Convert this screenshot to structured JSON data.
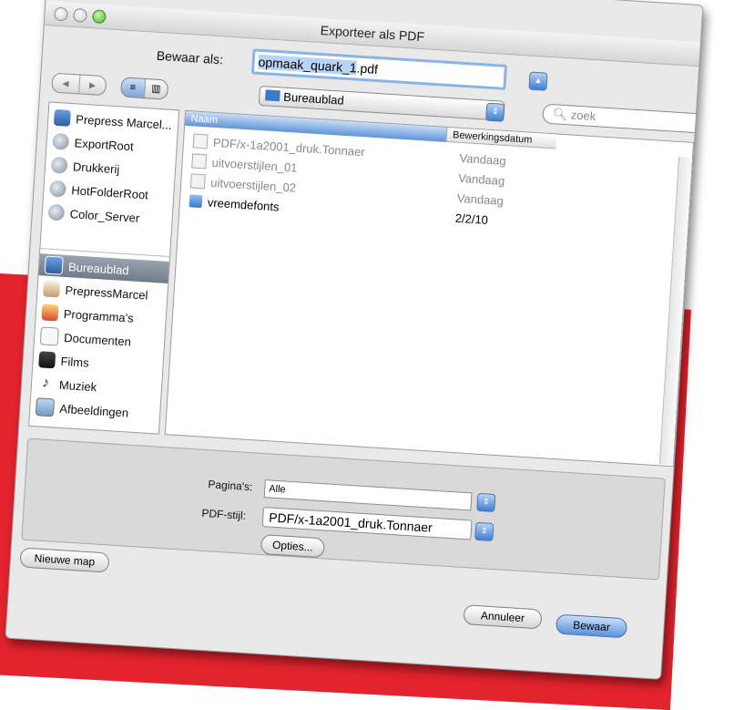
{
  "window": {
    "title": "Exporteer als PDF"
  },
  "save": {
    "label": "Bewaar als:",
    "filename_selected": "opmaak_quark_1",
    "filename_ext": ".pdf"
  },
  "location": {
    "label": "Bureaublad"
  },
  "search": {
    "placeholder": "zoek"
  },
  "sidebar": {
    "devices": [
      {
        "label": "Prepress Marcel...",
        "icon": "computer-icon"
      },
      {
        "label": "ExportRoot",
        "icon": "network-disk-icon"
      },
      {
        "label": "Drukkerij",
        "icon": "network-disk-icon"
      },
      {
        "label": "HotFolderRoot",
        "icon": "network-disk-icon"
      },
      {
        "label": "Color_Server",
        "icon": "network-disk-icon"
      }
    ],
    "places": [
      {
        "label": "Bureaublad",
        "icon": "desktop-icon"
      },
      {
        "label": "PrepressMarcel",
        "icon": "home-icon"
      },
      {
        "label": "Programma's",
        "icon": "applications-icon"
      },
      {
        "label": "Documenten",
        "icon": "documents-icon"
      },
      {
        "label": "Films",
        "icon": "movies-icon"
      },
      {
        "label": "Muziek",
        "icon": "music-icon"
      },
      {
        "label": "Afbeeldingen",
        "icon": "pictures-icon"
      }
    ]
  },
  "filelist": {
    "columns": {
      "name": "Naam",
      "date": "Bewerkingsdatum"
    },
    "rows": [
      {
        "name": "PDF/x-1a2001_druk.Tonnaer",
        "date": "Vandaag"
      },
      {
        "name": "uitvoerstijlen_01",
        "date": "Vandaag"
      },
      {
        "name": "uitvoerstijlen_02",
        "date": "Vandaag"
      },
      {
        "name": "vreemdefonts",
        "date": "2/2/10"
      }
    ]
  },
  "options": {
    "pages_label": "Pagina's:",
    "pages_value": "Alle",
    "style_label": "PDF-stijl:",
    "style_value": "PDF/x-1a2001_druk.Tonnaer",
    "options_button": "Opties..."
  },
  "buttons": {
    "new_folder": "Nieuwe map",
    "cancel": "Annuleer",
    "save": "Bewaar"
  },
  "colors": {
    "accent": "#5a93dd",
    "background_band": "#e3232d"
  }
}
